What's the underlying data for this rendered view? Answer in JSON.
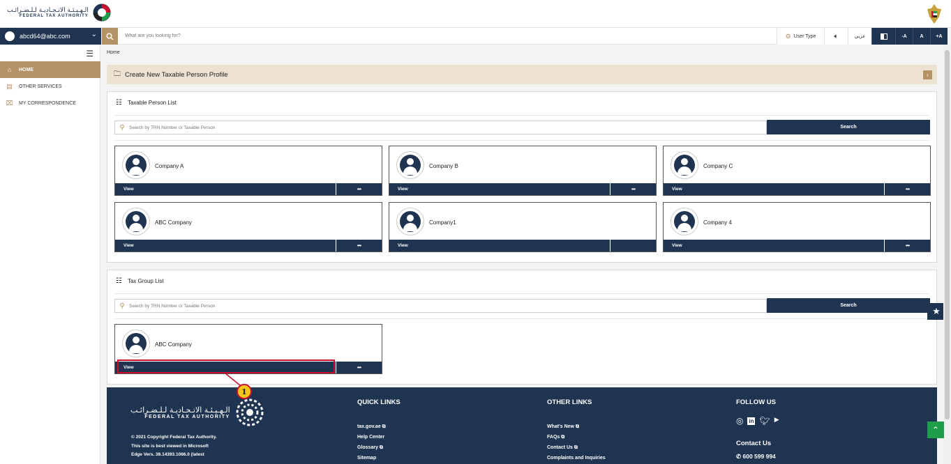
{
  "header": {
    "logo_ar": "الـهـيـئـة الاتـحـاديـة لـلـضـرائـب",
    "logo_en": "FEDERAL TAX AUTHORITY"
  },
  "user": {
    "email": "abcd64@abc.com"
  },
  "search": {
    "placeholder": "What are you looking for?"
  },
  "toolbar": {
    "user_type": "User Type",
    "arabic": "عربي",
    "font_minus": "-A",
    "font_normal": "A",
    "font_plus": "+A"
  },
  "sidebar": {
    "items": [
      {
        "label": "HOME",
        "icon": "home-icon",
        "active": true
      },
      {
        "label": "OTHER SERVICES",
        "icon": "services-icon",
        "active": false
      },
      {
        "label": "MY CORRESPONDENCE",
        "icon": "correspondence-icon",
        "active": false
      }
    ]
  },
  "breadcrumb": "Home",
  "create_profile": "Create New Taxable Person Profile",
  "taxable_list": {
    "title": "Taxable Person List",
    "search_placeholder": "Search by TRN Number or Taxable Person",
    "search_button": "Search",
    "cards": [
      {
        "name": "Company A",
        "action": "View",
        "more": "•••"
      },
      {
        "name": "Company B",
        "action": "View",
        "more": "•••"
      },
      {
        "name": "Company C",
        "action": "View",
        "more": "•••"
      },
      {
        "name": "ABC Company",
        "action": "View",
        "more": "•••"
      },
      {
        "name": "Company1",
        "action": "View",
        "more": ""
      },
      {
        "name": "Company 4",
        "action": "View",
        "more": "•••"
      }
    ]
  },
  "tax_group_list": {
    "title": "Tax Group List",
    "search_placeholder": "Search by TRN Number or Taxable Person",
    "search_button": "Search",
    "cards": [
      {
        "name": "ABC Company",
        "action": "View",
        "more": "•••"
      }
    ]
  },
  "callout_number": "1",
  "footer": {
    "logo_ar": "الـهـيـئـة الاتـحـاديـة لـلـضـرائـب",
    "logo_en": "FEDERAL TAX AUTHORITY",
    "copyright": "© 2021 Copyright Federal Tax Authority.",
    "best_viewed_1": "This site is best viewed in Microsoft",
    "best_viewed_2": "Edge Vers. 38.14393.1066.0 (latest",
    "quick_links": {
      "title": "QUICK LINKS",
      "links": [
        "tax.gov.ae",
        "Help Center",
        "Glossary",
        "Sitemap"
      ]
    },
    "other_links": {
      "title": "OTHER LINKS",
      "links": [
        "What's New",
        "FAQs",
        "Contact Us",
        "Complaints and Inquiries"
      ]
    },
    "follow": {
      "title": "FOLLOW US"
    },
    "contact": {
      "title": "Contact Us",
      "phone": "600 599 994"
    }
  },
  "colors": {
    "navy": "#1e3450",
    "gold": "#b59266",
    "beige": "#ede2d2",
    "highlight": "#c8102e",
    "green": "#1f9e49"
  }
}
